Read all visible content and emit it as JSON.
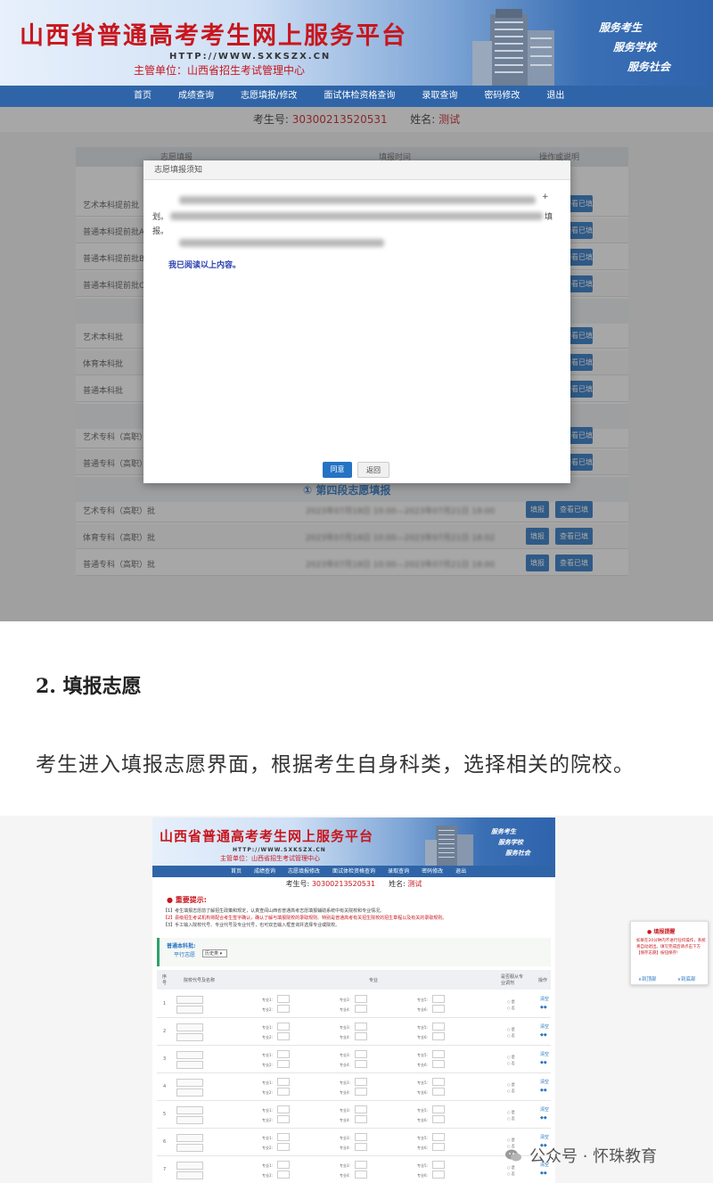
{
  "shot1": {
    "header": {
      "title": "山西省普通高考考生网上服务平台",
      "url": "HTTP://WWW.SXKSZX.CN",
      "subtitle": "主管单位：山西省招生考试管理中心",
      "slogans": [
        "服务考生",
        "服务学校",
        "服务社会"
      ]
    },
    "nav": [
      "首页",
      "成绩查询",
      "志愿填报/修改",
      "面试体检资格查询",
      "录取查询",
      "密码修改",
      "退出"
    ],
    "student": {
      "id_label": "考生号:",
      "id_value": "30300213520531",
      "name_label": "姓名:",
      "name_value": "测试"
    },
    "table": {
      "headers": [
        "志愿填报",
        "填报时间",
        "操作或说明"
      ],
      "rows": [
        {
          "label": "艺术本科提前批"
        },
        {
          "label": "普通本科提前批A"
        },
        {
          "label": "普通本科提前批B"
        },
        {
          "label": "普通本科提前批C"
        },
        {
          "label": "艺术本科批"
        },
        {
          "label": "体育本科批"
        },
        {
          "label": "普通本科批"
        },
        {
          "label": "艺术专科（高职）"
        },
        {
          "label": "普通专科（高职）"
        },
        {
          "label": "艺术专科（高职）批",
          "time": "2023年07月18日 10:00—2023年07月21日 18:00"
        },
        {
          "label": "体育专科（高职）批",
          "time": "2023年07月18日 10:00—2023年07月21日 18:02"
        },
        {
          "label": "普通专科（高职）批",
          "time": "2023年07月18日 10:00—2023年07月21日 18:00"
        }
      ],
      "section_label": "① 第四段志愿填报",
      "btn_fill": "填报",
      "btn_view": "查看已填"
    },
    "modal": {
      "title": "志愿填报须知",
      "char_plus": "+",
      "char_hua": "划。",
      "char_tian": "填",
      "char_bao": "报。",
      "confirm": "我已阅读以上内容。",
      "agree_btn": "同意",
      "back_btn": "返回"
    }
  },
  "article": {
    "heading": "2. 填报志愿",
    "paragraph": "考生进入填报志愿界面，根据考生自身科类，选择相关的院校。"
  },
  "shot2": {
    "header": {
      "title": "山西省普通高考考生网上服务平台",
      "url": "HTTP://WWW.SXKSZX.CN",
      "subtitle": "主管单位：山西省招生考试管理中心",
      "slogans": [
        "服务考生",
        "服务学校",
        "服务社会"
      ]
    },
    "nav": [
      "首页",
      "成绩查询",
      "志愿填报修改",
      "面试体检资格查询",
      "录取查询",
      "密码修改",
      "退出"
    ],
    "student": {
      "id_label": "考生号:",
      "id_value": "30300213520531",
      "name_label": "姓名:",
      "name_value": "测试"
    },
    "notice": {
      "title": "重要提示:",
      "lines": [
        "【1】考生填报志愿前了解招生政策和规定，认真查阅山西省普通高考志愿填报辅助系统中有关院校和专业情况。",
        "【2】县级招生考试机构将配合考生签字确认，确认了解与填报院校的录取规则、特别是普通高考有关招生院校的招生章程以及有关的录取规则。",
        "【3】手工输入院校代号、专业代号及专业代号，也可双击输入框查询并选择专业或院校。"
      ]
    },
    "batch": {
      "title": "普通本科批:",
      "tab": "平行志愿",
      "select": "历史类"
    },
    "grid_headers": {
      "idx": "序号",
      "school": "院校代号及名称",
      "major": "专业",
      "adjust": "是否服从专业调剂",
      "op": "操作"
    },
    "grid_rows": [
      "1",
      "2",
      "3",
      "4",
      "5",
      "6",
      "7"
    ],
    "row_labels": {
      "major1": "专业1:",
      "major2": "专业2:",
      "major3": "专业3:",
      "major4": "专业4:",
      "major5": "专业5:",
      "major6": "专业6:",
      "yes": "是",
      "no": "否",
      "clear": "清空",
      "arrows": "◆◆"
    },
    "float_panel": {
      "title": "填报提醒",
      "text": "如果在20分钟内不进行任何操作，系统将自动退出。填写完成后请点击下方【保存志愿】按钮保存!",
      "link_top": "∧到顶部",
      "link_bottom": "∨到底部"
    }
  },
  "watermark": {
    "text": "公众号 · 怀珠教育"
  },
  "colors": {
    "red": "#c8161d",
    "nav_blue": "#2f65a8",
    "button_blue": "#2573c4"
  }
}
